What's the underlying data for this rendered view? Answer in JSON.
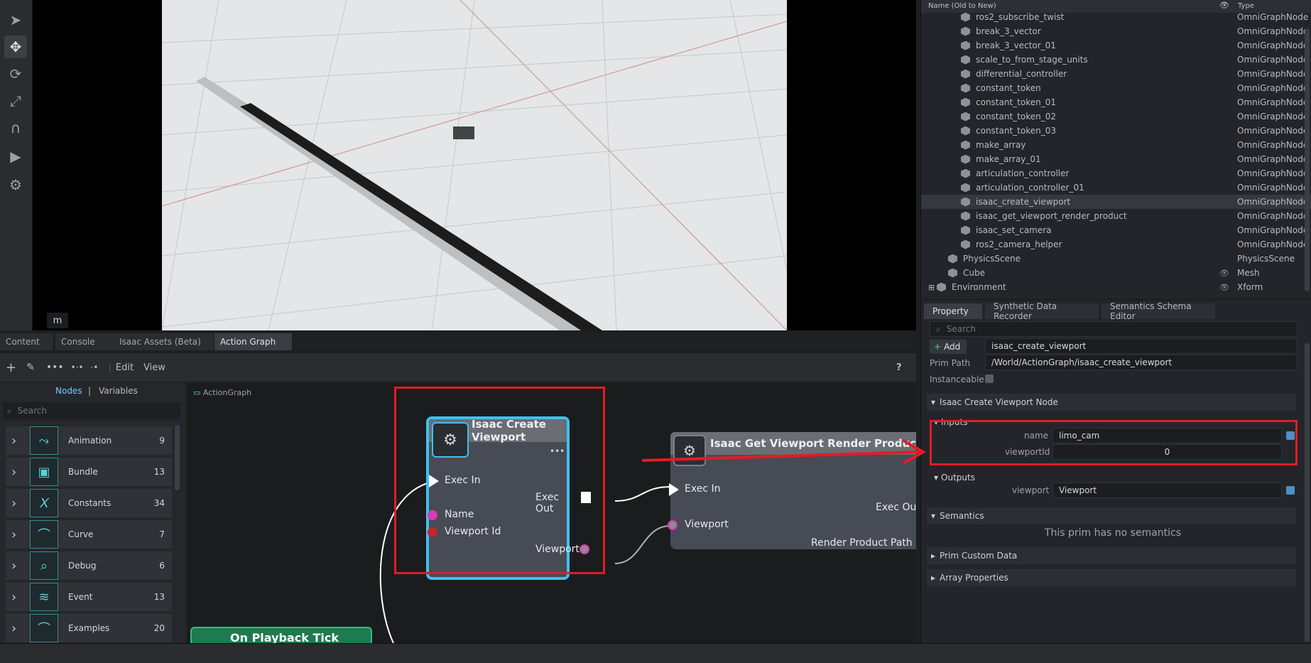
{
  "viewport": {
    "badge": "m"
  },
  "toolbar_left": {
    "tools": [
      "select-icon",
      "move-icon",
      "rotate-icon",
      "scale-icon",
      "snap-icon",
      "play-icon",
      "settings-icon"
    ]
  },
  "stage": {
    "header": {
      "name": "Name (Old to New)",
      "type": "Type"
    },
    "rows": [
      {
        "name": "ros2_subscribe_twist",
        "type": "OmniGraphNode"
      },
      {
        "name": "break_3_vector",
        "type": "OmniGraphNode"
      },
      {
        "name": "break_3_vector_01",
        "type": "OmniGraphNode"
      },
      {
        "name": "scale_to_from_stage_units",
        "type": "OmniGraphNode"
      },
      {
        "name": "differential_controller",
        "type": "OmniGraphNode"
      },
      {
        "name": "constant_token",
        "type": "OmniGraphNode"
      },
      {
        "name": "constant_token_01",
        "type": "OmniGraphNode"
      },
      {
        "name": "constant_token_02",
        "type": "OmniGraphNode"
      },
      {
        "name": "constant_token_03",
        "type": "OmniGraphNode"
      },
      {
        "name": "make_array",
        "type": "OmniGraphNode"
      },
      {
        "name": "make_array_01",
        "type": "OmniGraphNode"
      },
      {
        "name": "articulation_controller",
        "type": "OmniGraphNode"
      },
      {
        "name": "articulation_controller_01",
        "type": "OmniGraphNode"
      },
      {
        "name": "isaac_create_viewport",
        "type": "OmniGraphNode"
      },
      {
        "name": "isaac_get_viewport_render_product",
        "type": "OmniGraphNode"
      },
      {
        "name": "isaac_set_camera",
        "type": "OmniGraphNode"
      },
      {
        "name": "ros2_camera_helper",
        "type": "OmniGraphNode"
      },
      {
        "name": "PhysicsScene",
        "type": "PhysicsScene"
      },
      {
        "name": "Cube",
        "type": "Mesh"
      },
      {
        "name": "Environment",
        "type": "Xform"
      }
    ]
  },
  "bottom_tabs": [
    "Content",
    "Console",
    "Isaac Assets (Beta)",
    "Action Graph"
  ],
  "ag_toolbar": {
    "edit": "Edit",
    "view": "View",
    "help": "?"
  },
  "library": {
    "tabs": {
      "nodes": "Nodes",
      "sep": "|",
      "variables": "Variables"
    },
    "search_placeholder": "Search",
    "items": [
      {
        "label": "Animation",
        "count": "9"
      },
      {
        "label": "Bundle",
        "count": "13"
      },
      {
        "label": "Constants",
        "count": "34"
      },
      {
        "label": "Curve",
        "count": "7"
      },
      {
        "label": "Debug",
        "count": "6"
      },
      {
        "label": "Event",
        "count": "13"
      },
      {
        "label": "Examples",
        "count": "20"
      }
    ]
  },
  "graph": {
    "breadcrumb": "ActionGraph",
    "node1": {
      "title": "Isaac Create Viewport",
      "exec_in": "Exec In",
      "exec_out": "Exec Out",
      "name": "Name",
      "viewport_id": "Viewport Id",
      "viewport": "Viewport",
      "menu": "•••"
    },
    "node2": {
      "title": "Isaac Get Viewport Render Produc",
      "exec_in": "Exec In",
      "exec_out": "Exec Ou",
      "viewport": "Viewport",
      "render_product": "Render Product Path"
    },
    "node3": {
      "title": "On Playback Tick"
    }
  },
  "property": {
    "tabs": [
      "Property",
      "Synthetic Data Recorder",
      "Semantics Schema Editor"
    ],
    "search_placeholder": "Search",
    "add_label": "Add",
    "prim_name": "isaac_create_viewport",
    "prim_path_label": "Prim Path",
    "prim_path": "/World/ActionGraph/isaac_create_viewport",
    "instanceable_label": "Instanceable",
    "node_section": "Isaac Create Viewport Node",
    "inputs_label": "Inputs",
    "name_label": "name",
    "name_value": "limo_cam",
    "viewportid_label": "viewportId",
    "viewportid_value": "0",
    "outputs_label": "Outputs",
    "viewport_label": "viewport",
    "viewport_value": "Viewport",
    "semantics_label": "Semantics",
    "semantics_msg": "This prim has no semantics",
    "custom_label": "Prim Custom Data",
    "array_label": "Array Properties"
  },
  "colors": {
    "highlight": "#e31c25",
    "node_selected": "#3ec2ee",
    "accent": "#6fd0ff"
  }
}
